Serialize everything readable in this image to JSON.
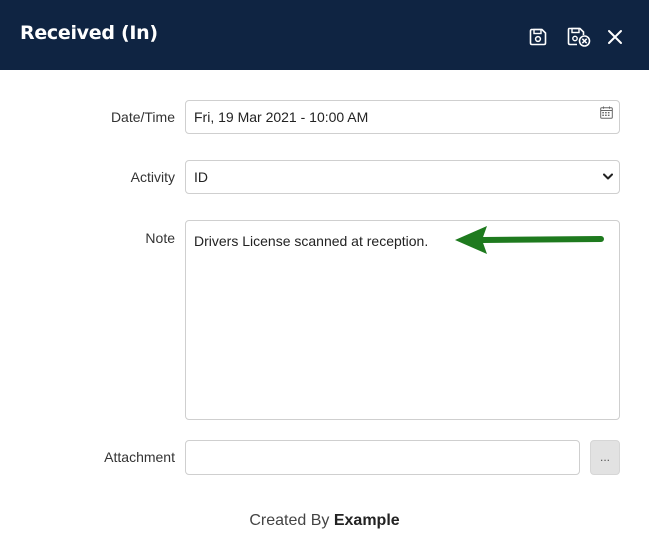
{
  "header": {
    "title": "Received (In)",
    "icons": [
      "save-icon",
      "save-close-icon",
      "close-icon"
    ]
  },
  "form": {
    "datetime": {
      "label": "Date/Time",
      "value": "Fri, 19 Mar 2021 - 10:00 AM",
      "icon": "calendar-icon"
    },
    "activity": {
      "label": "Activity",
      "value": "ID",
      "icon": "chevron-down-icon"
    },
    "note": {
      "label": "Note",
      "value": "Drivers License scanned at reception."
    },
    "attachment": {
      "label": "Attachment",
      "value": "",
      "browse_label": "..."
    }
  },
  "footer": {
    "created_by_prefix": "Created By",
    "created_by_name": "Example"
  },
  "colors": {
    "header_bg": "#0f2442",
    "annotation_arrow": "#1e7a1e"
  }
}
